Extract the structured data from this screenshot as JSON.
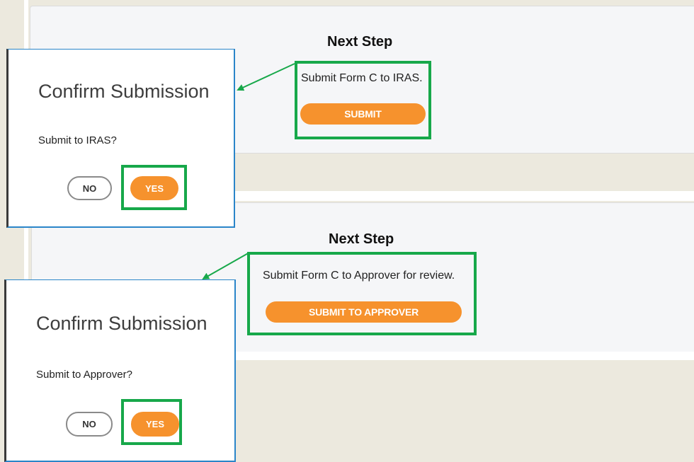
{
  "panels": [
    {
      "title": "Next Step",
      "description": "Submit Form C to IRAS.",
      "button_label": "SUBMIT"
    },
    {
      "title": "Next Step",
      "description": "Submit Form C to Approver for review.",
      "button_label": "SUBMIT TO APPROVER"
    }
  ],
  "dialogs": [
    {
      "title": "Confirm Submission",
      "question": "Submit to IRAS?",
      "no_label": "NO",
      "yes_label": "YES"
    },
    {
      "title": "Confirm Submission",
      "question": "Submit to Approver?",
      "no_label": "NO",
      "yes_label": "YES"
    }
  ],
  "colors": {
    "accent_orange": "#f6922d",
    "highlight_green": "#17a84a",
    "page_background": "#ece9de",
    "panel_background": "#f5f6f8"
  },
  "icons": {
    "annotation": "arrow-left-icon"
  }
}
